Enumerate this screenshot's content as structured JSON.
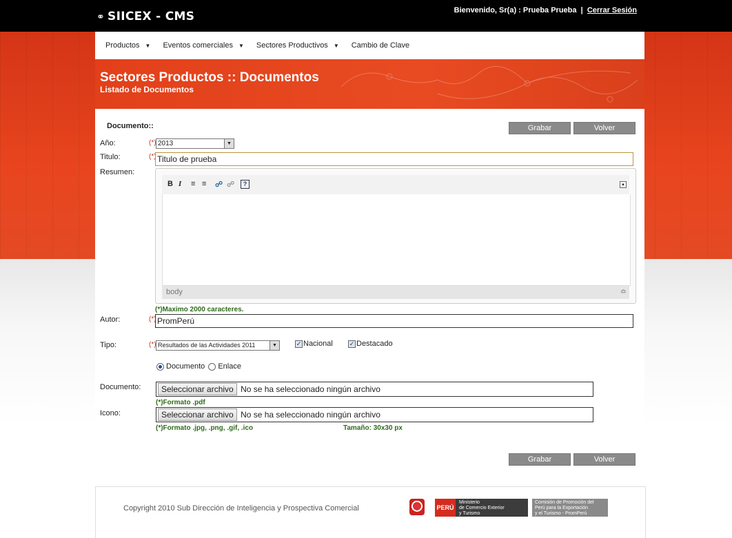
{
  "header": {
    "logo": "SIICEX - CMS",
    "welcome": "Bienvenido, Sr(a) : Prueba Prueba",
    "separator": "|",
    "logout": "Cerrar Sesión"
  },
  "nav": [
    {
      "label": "Productos",
      "has_caret": true
    },
    {
      "label": "Eventos comerciales",
      "has_caret": true
    },
    {
      "label": "Sectores Productivos",
      "has_caret": true
    },
    {
      "label": "Cambio de Clave",
      "has_caret": false
    }
  ],
  "banner": {
    "title": "Sectores Productos :: Documentos",
    "subtitle": "Listado de Documentos"
  },
  "form": {
    "section": "Documento::",
    "save": "Grabar",
    "back": "Volver",
    "required_mark": "(*)",
    "year_label": "Año:",
    "year_value": "2013",
    "title_label": "Titulo:",
    "title_value": "Titulo de prueba",
    "summary_label": "Resumen:",
    "editor_status": "body",
    "summary_hint": "(*)Maximo 2000 caracteres.",
    "author_label": "Autor:",
    "author_value": "PromPerú",
    "type_label": "Tipo:",
    "type_value": "Resultados de las Actividades 2011",
    "national_label": "Nacional",
    "national_checked": true,
    "featured_label": "Destacado",
    "featured_checked": true,
    "radio_document": "Documento",
    "radio_link": "Enlace",
    "selected_radio": "Documento",
    "document_label": "Documento:",
    "file_button": "Seleccionar archivo",
    "no_file": "No se ha seleccionado ningún archivo",
    "document_hint": "(*)Formato .pdf",
    "icon_label": "Icono:",
    "icon_hint": "(*)Formato .jpg, .png, .gif, .ico",
    "size_hint": "Tamaño: 30x30 px"
  },
  "footer": {
    "copyright": "Copyright 2010 Sub Dirección de Inteligencia y Prospectiva Comercial",
    "peru": "PERÚ",
    "ministry_line1": "Ministerio",
    "ministry_line2": "de Comercio Exterior",
    "ministry_line3": "y Turismo",
    "prom_line1": "Comisión de Promoción del",
    "prom_line2": "Perú para la Exportación",
    "prom_line3": "y el Turismo - PromPerú"
  },
  "colors": {
    "brand_red": "#e2401a",
    "button_grey": "#8a8a8a",
    "hint_green": "#2f6b1a",
    "required_red": "#c0392b"
  }
}
